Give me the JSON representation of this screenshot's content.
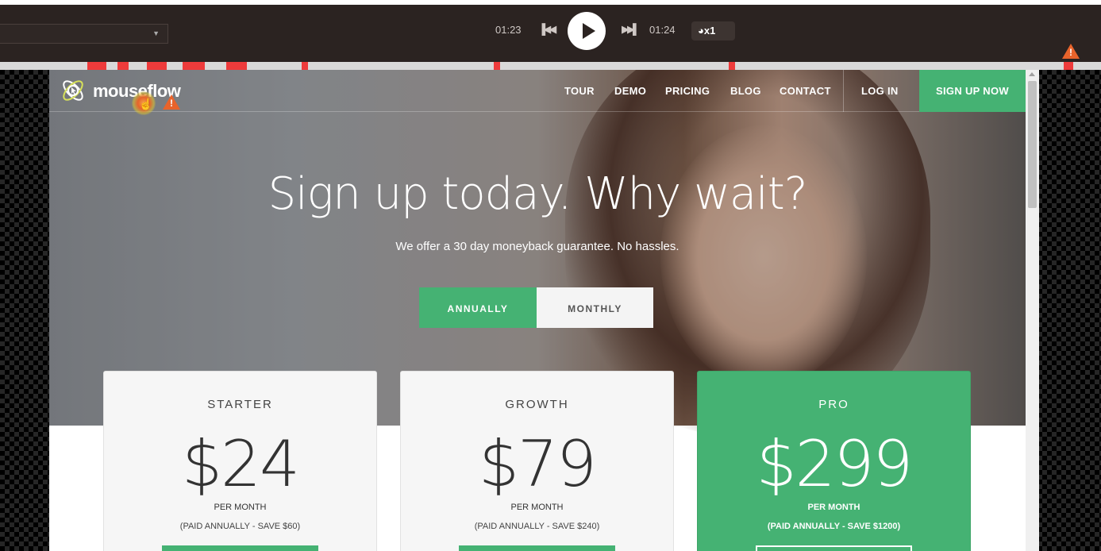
{
  "player": {
    "current_time": "01:23",
    "end_time": "01:24",
    "speed": "x1",
    "prev_icon": "skip-previous-icon",
    "next_icon": "skip-next-icon",
    "play_icon": "play-icon",
    "speed_icon": "speed-dial-icon",
    "warning_icon": "warning-icon"
  },
  "nav": {
    "brand": "mouseflow",
    "links": [
      "TOUR",
      "DEMO",
      "PRICING",
      "BLOG",
      "CONTACT"
    ],
    "login": "LOG IN",
    "signup": "SIGN UP NOW"
  },
  "hero": {
    "title": "Sign up today. Why wait?",
    "subtitle": "We offer a 30 day moneyback guarantee. No hassles."
  },
  "billing_toggle": {
    "annually": "ANNUALLY",
    "monthly": "MONTHLY",
    "selected": "annually"
  },
  "plans": [
    {
      "name": "STARTER",
      "price": "$24",
      "per": "PER MONTH",
      "note": "(PAID ANNUALLY - SAVE $60)"
    },
    {
      "name": "GROWTH",
      "price": "$79",
      "per": "PER MONTH",
      "note": "(PAID ANNUALLY - SAVE $240)"
    },
    {
      "name": "PRO",
      "price": "$299",
      "per": "PER MONTH",
      "note": "(PAID ANNUALLY - SAVE $1200)"
    }
  ],
  "colors": {
    "accent": "#45b273",
    "player_bg": "#2b2321",
    "warning": "#e8632b",
    "timeline_mark": "#ee3b3b"
  }
}
